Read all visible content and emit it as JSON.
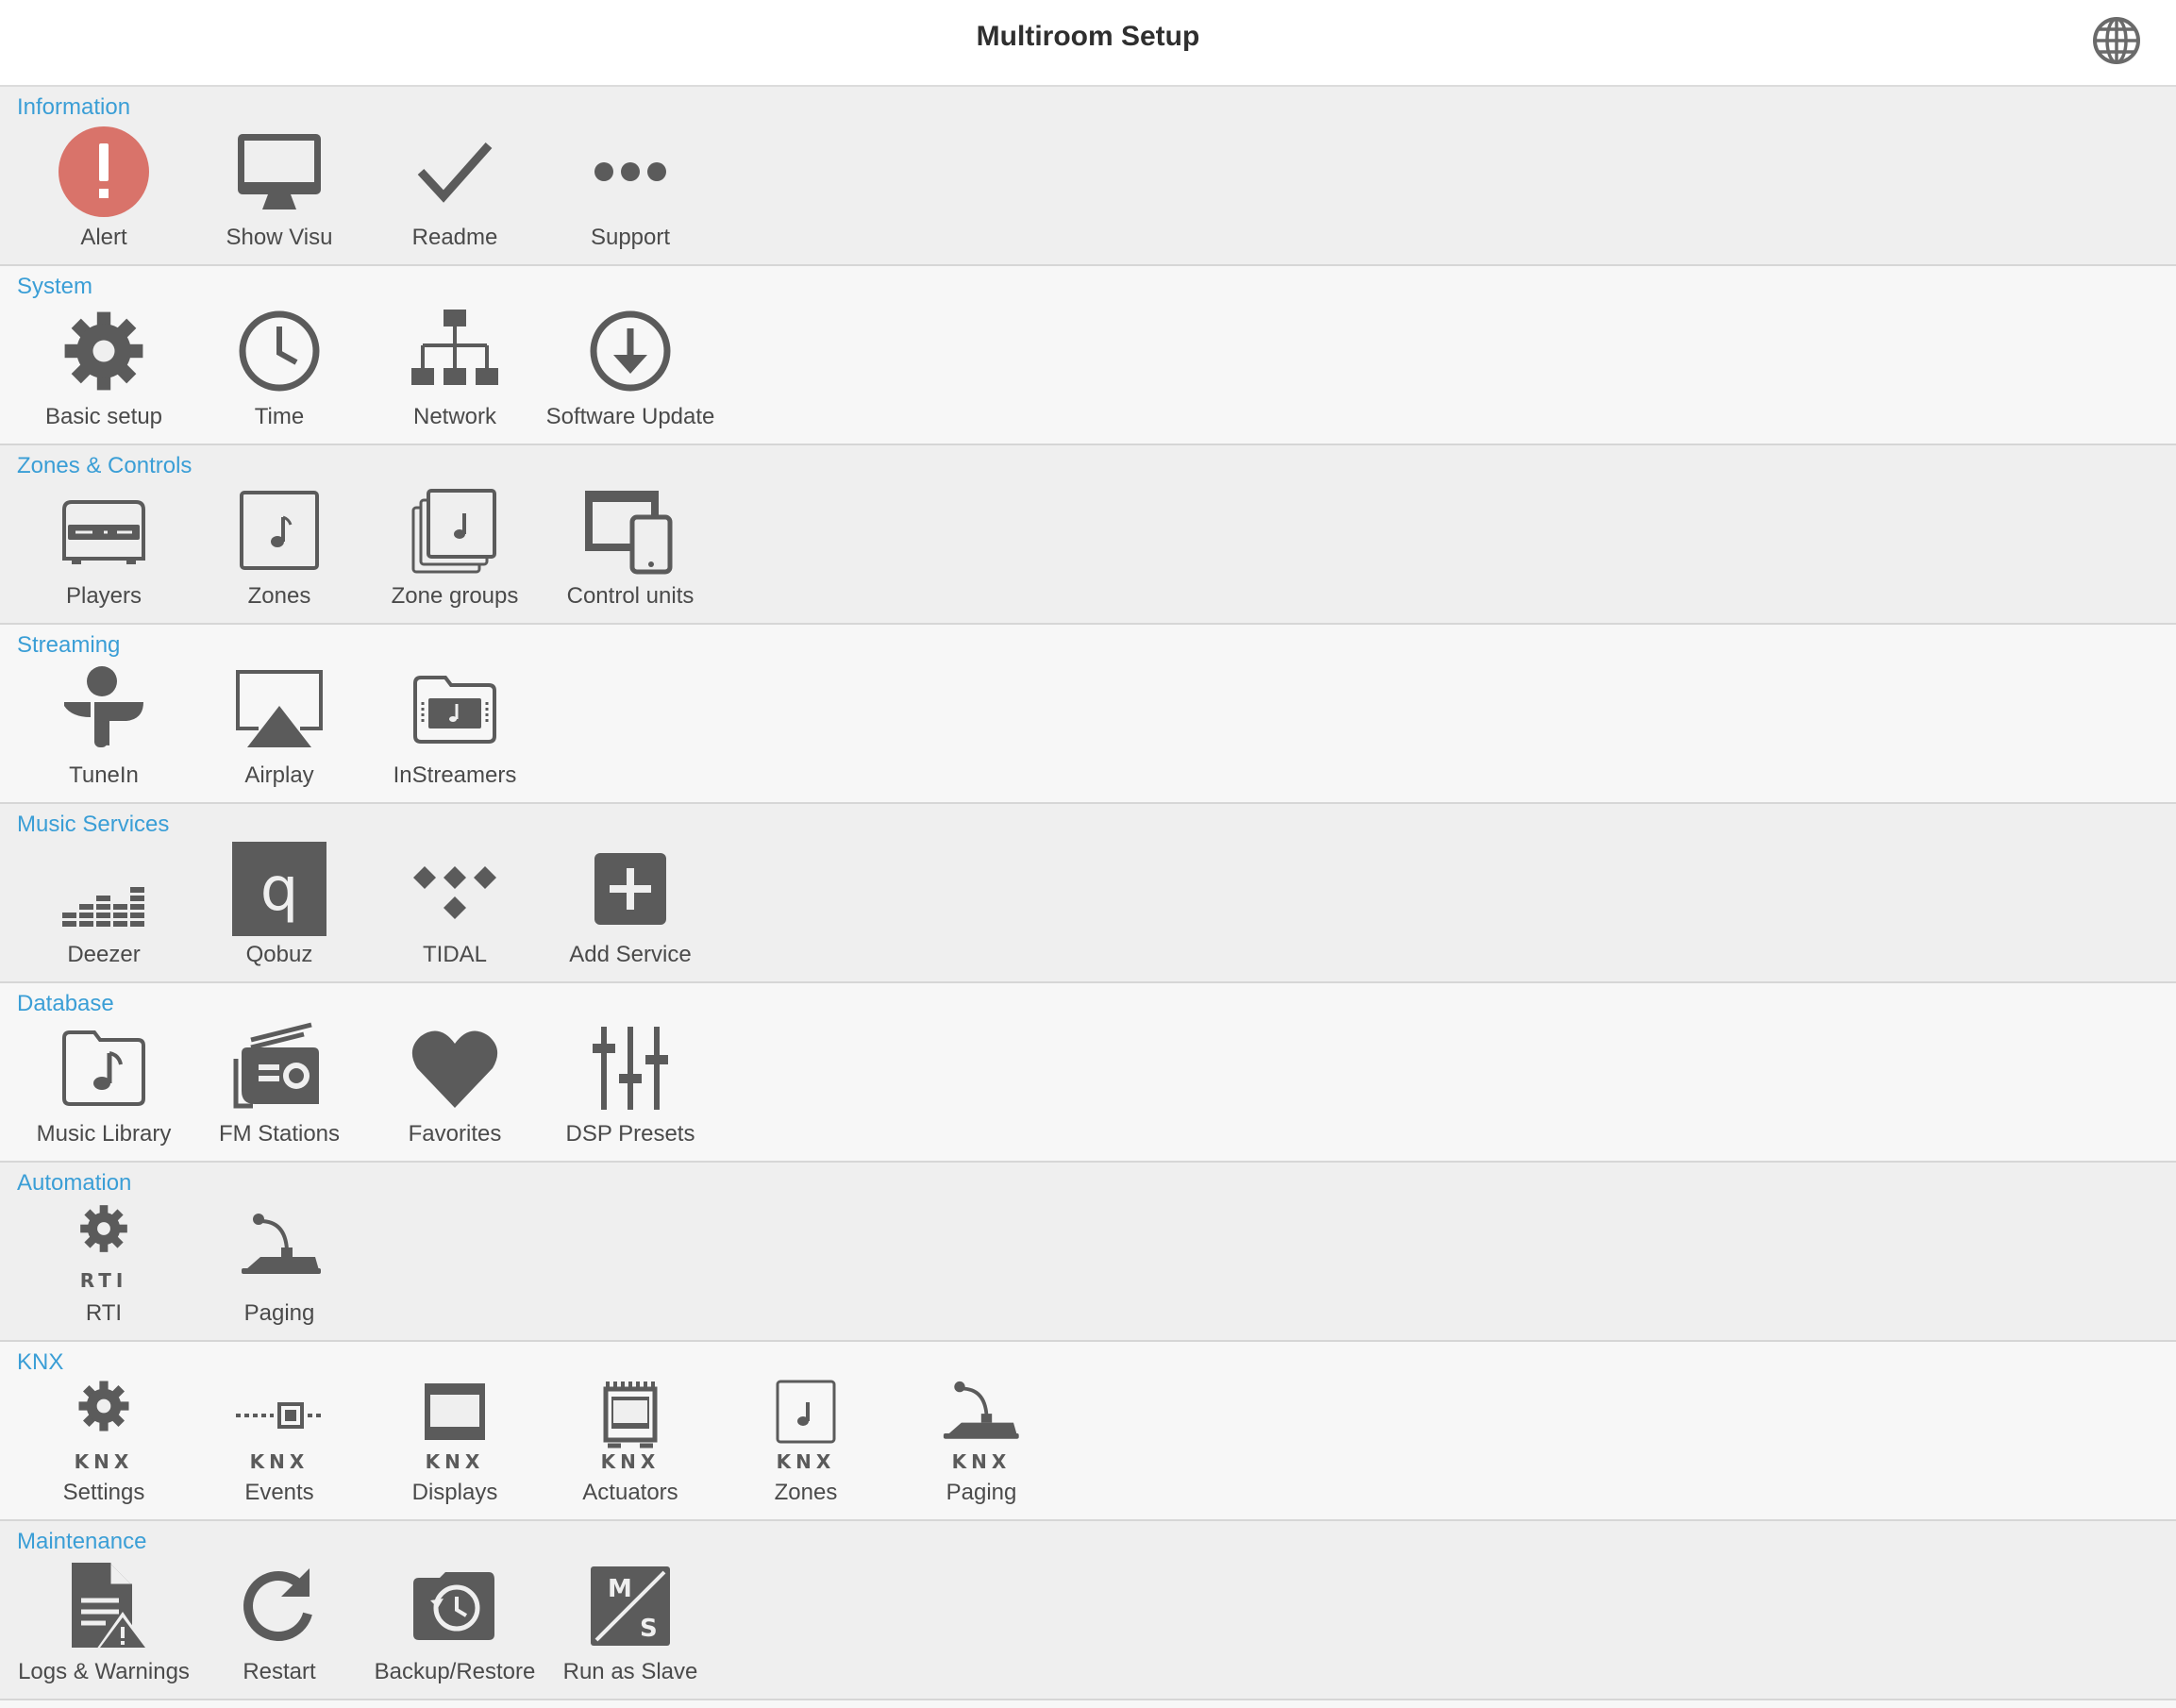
{
  "header": {
    "title": "Multiroom Setup",
    "globe_icon": "globe-icon"
  },
  "colors": {
    "accent": "#3a9ed6",
    "icon": "#5b5b5b",
    "alert": "#d9736a"
  },
  "sections": [
    {
      "title": "Information",
      "items": [
        {
          "label": "Alert",
          "icon": "alert-icon"
        },
        {
          "label": "Show Visu",
          "icon": "monitor-icon"
        },
        {
          "label": "Readme",
          "icon": "checkmark-icon"
        },
        {
          "label": "Support",
          "icon": "ellipsis-icon"
        }
      ]
    },
    {
      "title": "System",
      "items": [
        {
          "label": "Basic setup",
          "icon": "gear-icon"
        },
        {
          "label": "Time",
          "icon": "clock-icon"
        },
        {
          "label": "Network",
          "icon": "network-icon"
        },
        {
          "label": "Software Update",
          "icon": "download-icon"
        }
      ]
    },
    {
      "title": "Zones & Controls",
      "items": [
        {
          "label": "Players",
          "icon": "player-device-icon"
        },
        {
          "label": "Zones",
          "icon": "music-zone-icon"
        },
        {
          "label": "Zone groups",
          "icon": "zone-groups-icon"
        },
        {
          "label": "Control units",
          "icon": "devices-icon"
        }
      ]
    },
    {
      "title": "Streaming",
      "items": [
        {
          "label": "TuneIn",
          "icon": "tunein-icon"
        },
        {
          "label": "Airplay",
          "icon": "airplay-icon"
        },
        {
          "label": "InStreamers",
          "icon": "instreamer-icon"
        }
      ]
    },
    {
      "title": "Music Services",
      "items": [
        {
          "label": "Deezer",
          "icon": "deezer-icon"
        },
        {
          "label": "Qobuz",
          "icon": "qobuz-icon"
        },
        {
          "label": "TIDAL",
          "icon": "tidal-icon"
        },
        {
          "label": "Add Service",
          "icon": "add-icon"
        }
      ]
    },
    {
      "title": "Database",
      "items": [
        {
          "label": "Music Library",
          "icon": "music-folder-icon"
        },
        {
          "label": "FM Stations",
          "icon": "radio-icon"
        },
        {
          "label": "Favorites",
          "icon": "heart-icon"
        },
        {
          "label": "DSP Presets",
          "icon": "sliders-icon"
        }
      ]
    },
    {
      "title": "Automation",
      "items": [
        {
          "label": "RTI",
          "icon": "rti-gear-icon",
          "sub": "RTI"
        },
        {
          "label": "Paging",
          "icon": "microphone-icon"
        }
      ]
    },
    {
      "title": "KNX",
      "items": [
        {
          "label": "Settings",
          "icon": "knx-gear-icon",
          "sub": "KNX"
        },
        {
          "label": "Events",
          "icon": "knx-events-icon",
          "sub": "KNX"
        },
        {
          "label": "Displays",
          "icon": "knx-display-icon",
          "sub": "KNX"
        },
        {
          "label": "Actuators",
          "icon": "knx-actuator-icon",
          "sub": "KNX"
        },
        {
          "label": "Zones",
          "icon": "knx-zone-icon",
          "sub": "KNX"
        },
        {
          "label": "Paging",
          "icon": "knx-microphone-icon",
          "sub": "KNX"
        }
      ]
    },
    {
      "title": "Maintenance",
      "items": [
        {
          "label": "Logs & Warnings",
          "icon": "log-warning-icon"
        },
        {
          "label": "Restart",
          "icon": "restart-icon"
        },
        {
          "label": "Backup/Restore",
          "icon": "backup-icon"
        },
        {
          "label": "Run as Slave",
          "icon": "master-slave-icon",
          "glyphs": [
            "M",
            "S"
          ]
        }
      ]
    }
  ]
}
